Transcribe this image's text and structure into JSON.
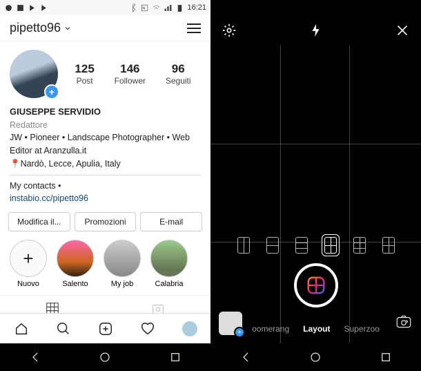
{
  "status": {
    "time": "16:21"
  },
  "profile": {
    "username": "pipetto96",
    "stats": {
      "posts": {
        "count": "125",
        "label": "Post"
      },
      "followers": {
        "count": "146",
        "label": "Follower"
      },
      "following": {
        "count": "96",
        "label": "Seguiti"
      }
    },
    "display_name": "GIUSEPPE SERVIDIO",
    "role": "Redattore",
    "bio_line": "JW • Pioneer • Landscape Photographer • Web Editor at Aranzulla.it",
    "location": "📍Nardò, Lecce, Apulia, Italy",
    "contacts_label": "My contacts •",
    "link": "instabio.cc/pipetto96"
  },
  "buttons": {
    "edit": "Modifica il...",
    "promo": "Promozioni",
    "email": "E-mail"
  },
  "highlights": [
    {
      "label": "Nuovo"
    },
    {
      "label": "Salento"
    },
    {
      "label": "My job"
    },
    {
      "label": "Calabria"
    }
  ],
  "camera": {
    "modes": {
      "left": "oomerang",
      "center": "Layout",
      "right": "Superzoo"
    }
  }
}
